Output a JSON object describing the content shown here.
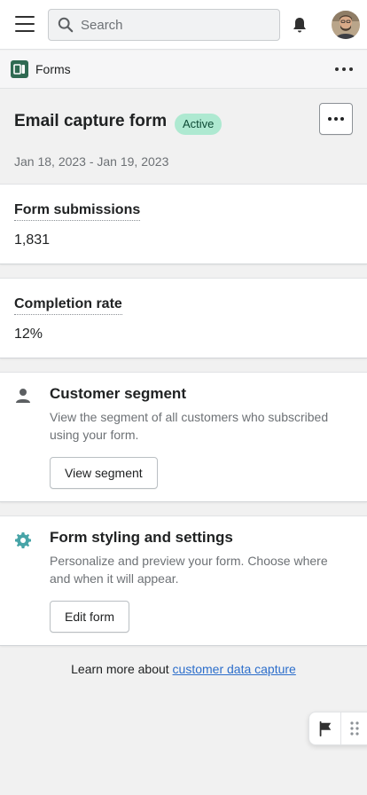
{
  "topbar": {
    "search_placeholder": "Search",
    "icons": [
      "hamburger-menu-icon",
      "search-icon",
      "bell-icon",
      "avatar"
    ]
  },
  "subbar": {
    "app_name": "Forms",
    "app_icon": "forms-app-icon",
    "app_icon_color": "#2f6a52"
  },
  "header": {
    "title": "Email capture form",
    "status": "Active",
    "status_bg": "#aee9d1",
    "date_range": "Jan 18, 2023 - Jan 19, 2023"
  },
  "metrics": [
    {
      "label": "Form submissions",
      "value": "1,831"
    },
    {
      "label": "Completion rate",
      "value": "12%"
    }
  ],
  "cards": {
    "segment": {
      "icon": "person-icon",
      "title": "Customer segment",
      "description": "View the segment of all customers who subscribed using your form.",
      "button": "View segment"
    },
    "styling": {
      "icon": "gear-icon",
      "icon_color": "#47a4a7",
      "title": "Form styling and settings",
      "description": "Personalize and preview your form. Choose where and when it will appear.",
      "button": "Edit form"
    }
  },
  "footer": {
    "learn_prefix": "Learn more about ",
    "learn_link": "customer data capture"
  },
  "accent_link_color": "#2c6ecb"
}
